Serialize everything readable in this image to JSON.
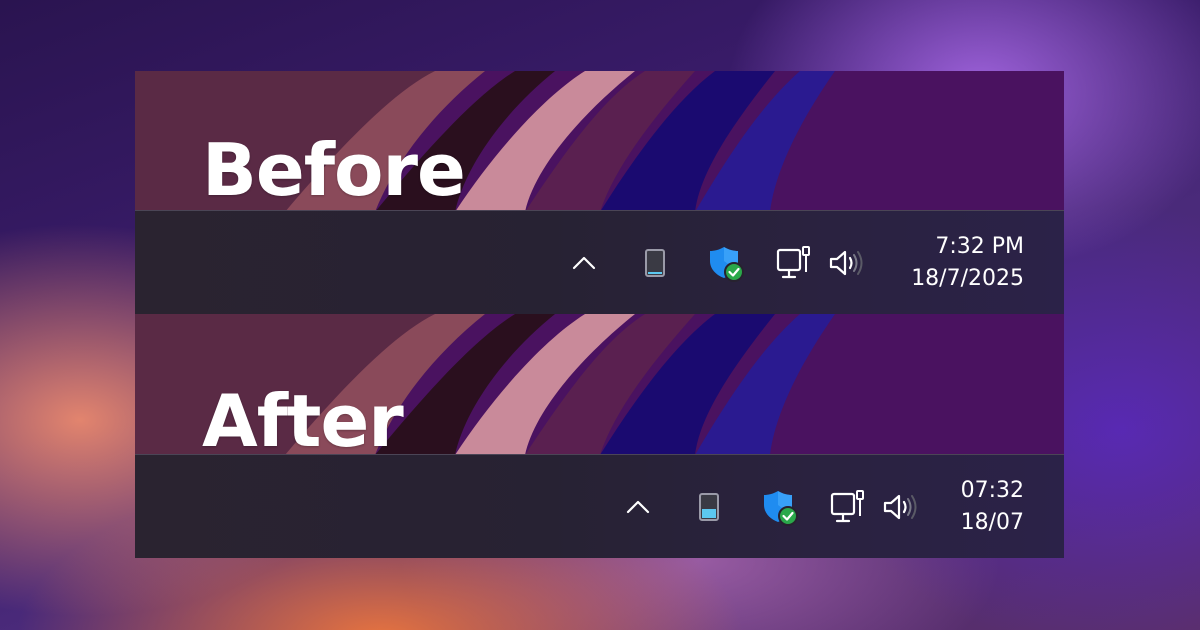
{
  "before": {
    "caption": "Before",
    "clock": {
      "time": "7:32 PM",
      "date": "18/7/2025"
    }
  },
  "after": {
    "caption": "After",
    "clock": {
      "time": "07:32",
      "date": "18/07"
    }
  },
  "tray_icons": [
    "chevron-up-icon",
    "battery-icon",
    "security-shield-icon",
    "wired-network-icon",
    "speaker-volume-icon"
  ],
  "colors": {
    "taskbar": "#27222f",
    "shield_blue": "#1f8cf0",
    "shield_check": "#2aa84a",
    "battery_fill": "#5cc8f0"
  }
}
